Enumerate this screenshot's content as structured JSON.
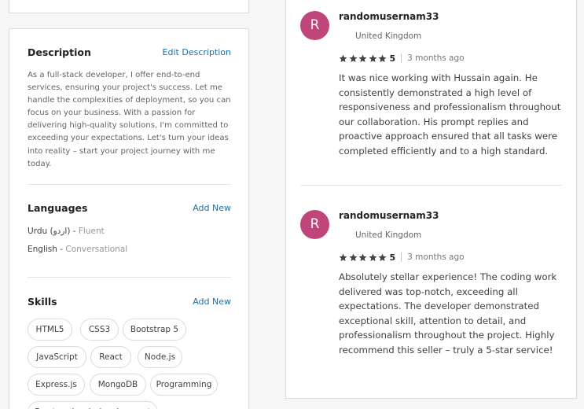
{
  "description": {
    "title": "Description",
    "action": "Edit Description",
    "text": "As a full-stack developer, I offer end-to-end services, ensuring your project's success. Let me handle the complexities of deployment, so you can focus on your business. With a passion for delivering high-quality solutions, I'm committed to exceeding your expectations. Let's turn your ideas into reality – start your project journey with me today."
  },
  "languages": {
    "title": "Languages",
    "action": "Add New",
    "items": [
      {
        "name": "Urdu (اردو)",
        "level": "Fluent"
      },
      {
        "name": "English",
        "level": "Conversational"
      }
    ]
  },
  "skills": {
    "title": "Skills",
    "action": "Add New",
    "items": [
      "HTML5",
      "CSS3",
      "Bootstrap 5",
      "JavaScript",
      "React",
      "Node.js",
      "Express.js",
      "MongoDB",
      "Programming",
      "Front-end web development"
    ]
  },
  "reviews": [
    {
      "initial": "R",
      "username": "randomusernam33",
      "country": "United Kingdom",
      "flag_icon": "uk-flag-icon",
      "rating": "5",
      "stars": 5,
      "time": "3 months ago",
      "text": "It was nice working with Hussain again. He consistently demonstrated a high level of responsiveness and professionalism throughout our collaboration. His prompt replies and proactive approach ensured that all tasks were completed efficiently and to a high standard."
    },
    {
      "initial": "R",
      "username": "randomusernam33",
      "country": "United Kingdom",
      "flag_icon": "uk-flag-icon",
      "rating": "5",
      "stars": 5,
      "time": "3 months ago",
      "text": "Absolutely stellar experience! The coding work delivered was top-notch, exceeding all expectations. The developer demonstrated exceptional skill, attention to detail, and professionalism throughout the project. Highly recommend this seller – truly a 5-star service!"
    }
  ],
  "colors": {
    "avatar": "#c0457a",
    "link": "#1d6fa5",
    "star": "#404145"
  }
}
